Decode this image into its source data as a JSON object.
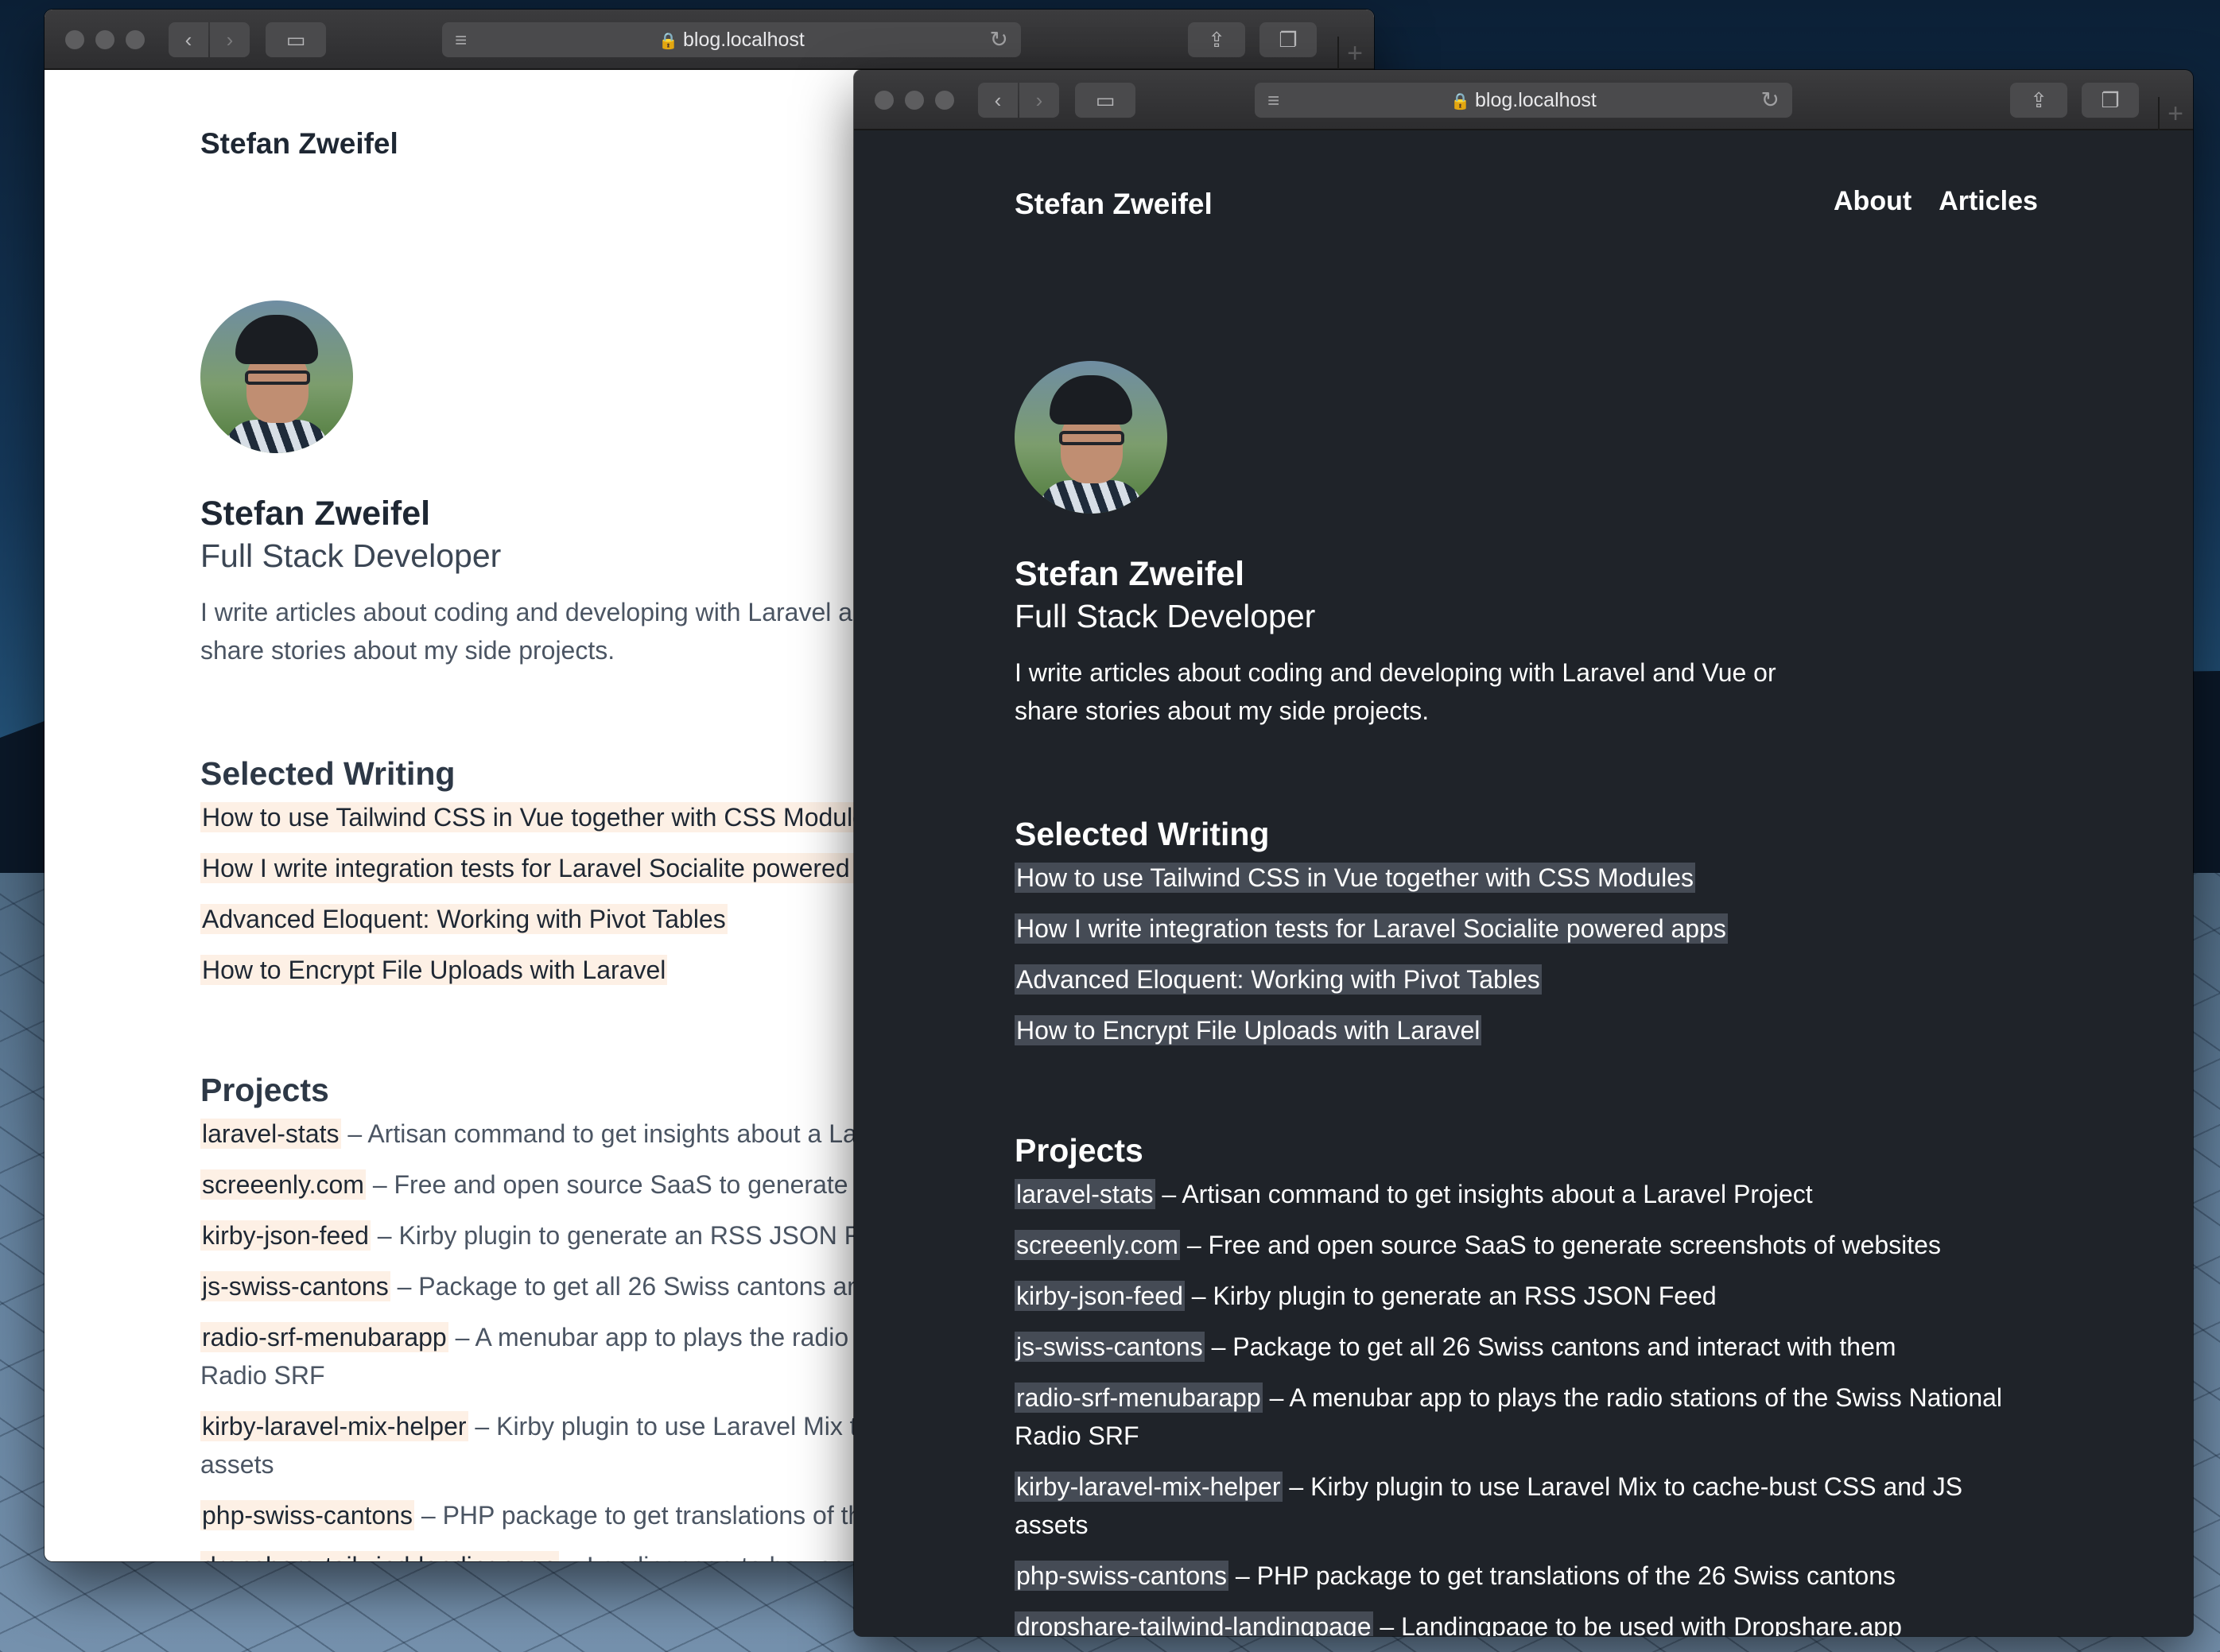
{
  "browser": {
    "url": "blog.localhost"
  },
  "site": {
    "title": "Stefan Zweifel",
    "nav": [
      "About",
      "Articles"
    ]
  },
  "profile": {
    "name": "Stefan Zweifel",
    "role": "Full Stack Developer",
    "bio": "I write articles about coding and developing with Laravel and Vue or share stories about my side projects."
  },
  "writing": {
    "heading": "Selected Writing",
    "items": [
      "How to use Tailwind CSS in Vue together with CSS Modules",
      "How I write integration tests for Laravel Socialite powered apps",
      "Advanced Eloquent: Working with Pivot Tables",
      "How to Encrypt File Uploads with Laravel"
    ]
  },
  "projects": {
    "heading": "Projects",
    "items": [
      {
        "name": "laravel-stats",
        "desc": " – Artisan command to get insights about a Laravel Project"
      },
      {
        "name": "screeenly.com",
        "desc": " – Free and open source SaaS to generate screenshots of websites"
      },
      {
        "name": "kirby-json-feed",
        "desc": " – Kirby plugin to generate an RSS JSON Feed"
      },
      {
        "name": "js-swiss-cantons",
        "desc": " – Package to get all 26 Swiss cantons and interact with them"
      },
      {
        "name": "radio-srf-menubarapp",
        "desc": " – A menubar app to plays the radio stations of the Swiss National Radio SRF"
      },
      {
        "name": "kirby-laravel-mix-helper",
        "desc": " – Kirby plugin to use Laravel Mix to cache-bust CSS and JS assets"
      },
      {
        "name": "php-swiss-cantons",
        "desc": " – PHP package to get translations of the 26 Swiss cantons"
      },
      {
        "name": "dropshare-tailwind-landingpage",
        "desc": " – Landingpage to be used with Dropshare.app"
      }
    ]
  }
}
